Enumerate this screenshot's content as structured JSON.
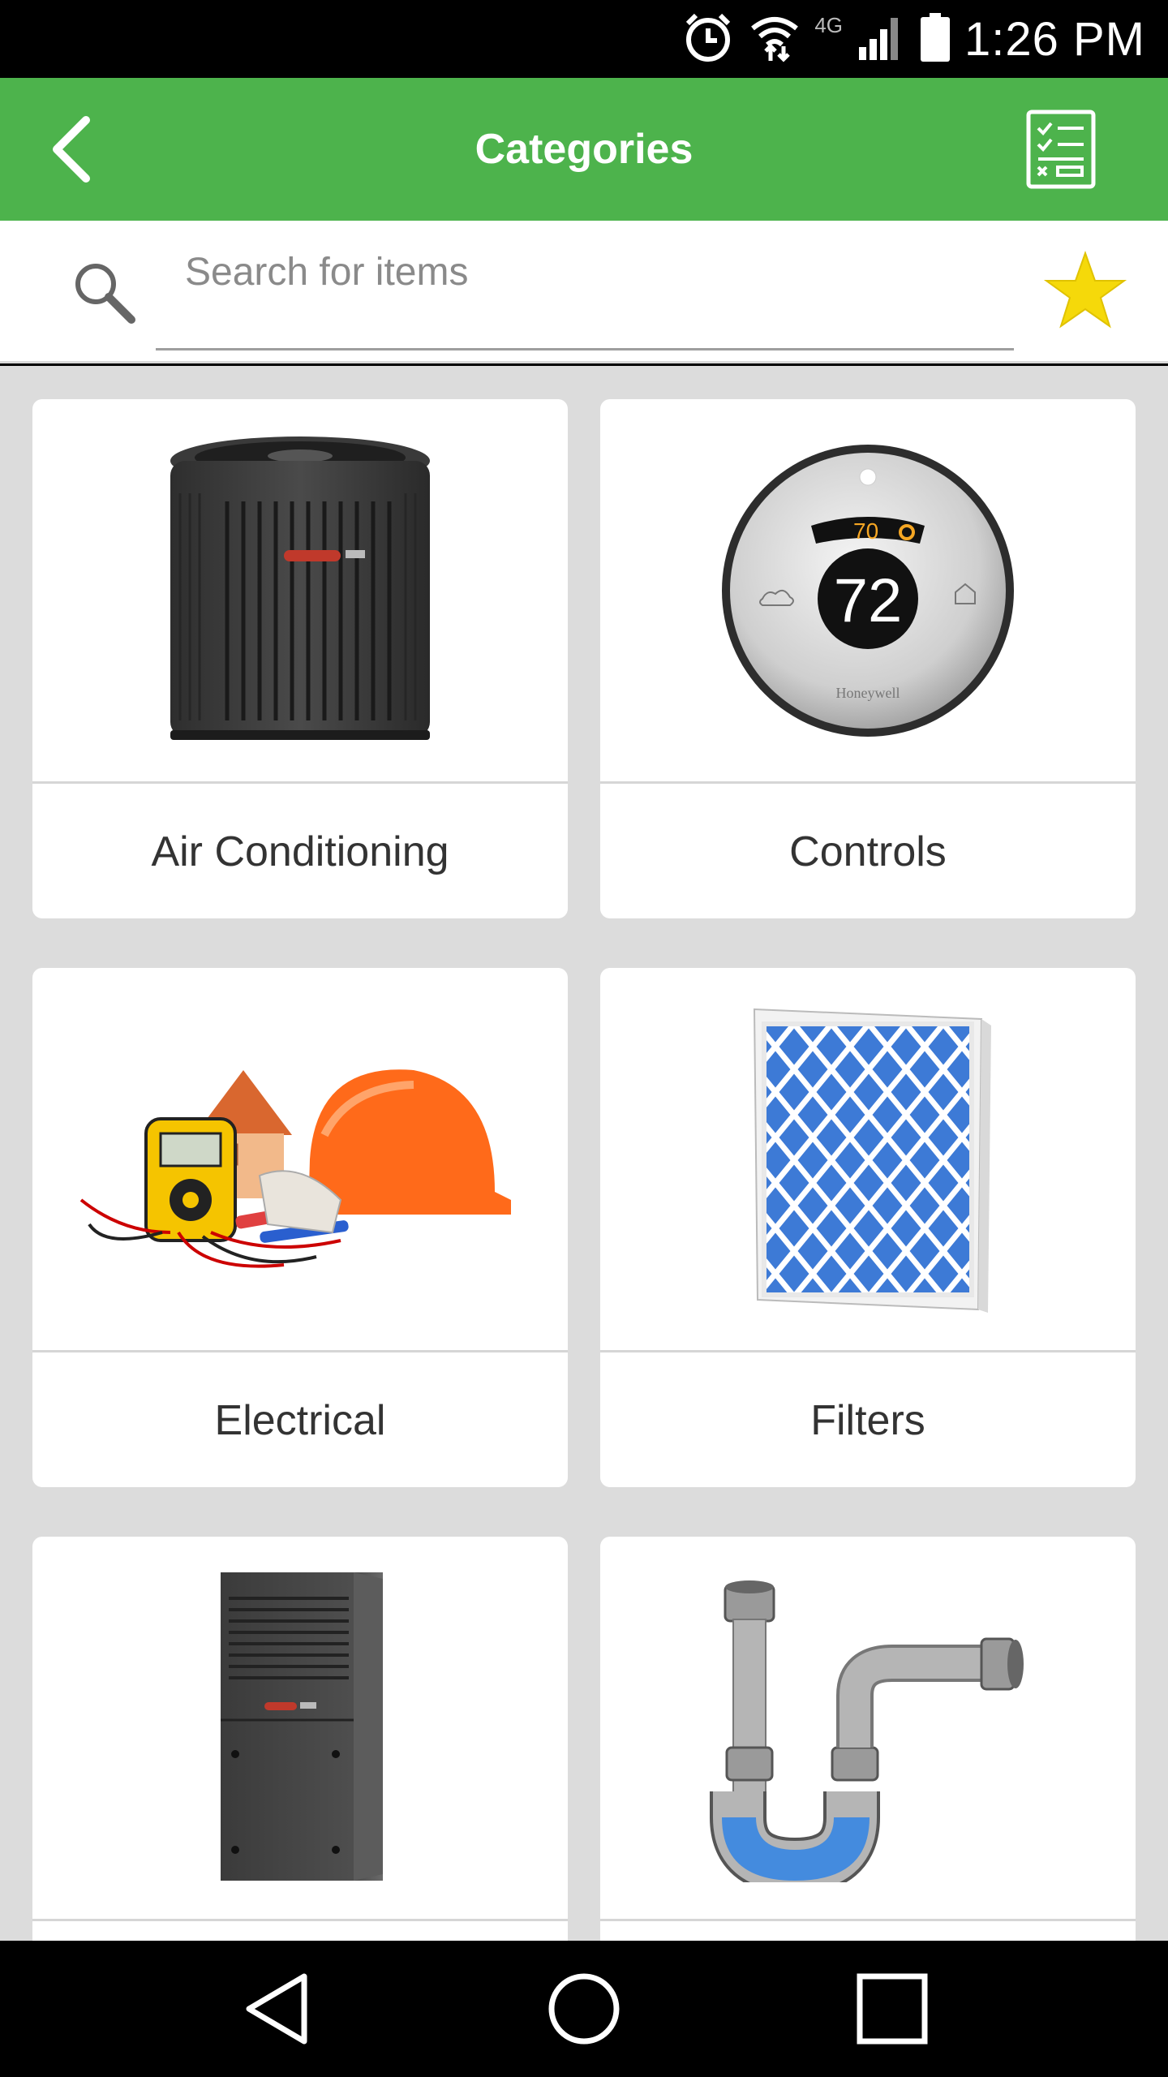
{
  "status_bar": {
    "time": "1:26 PM",
    "network": "4G",
    "icons": [
      "alarm-icon",
      "wifi-icon",
      "signal-icon",
      "battery-icon"
    ]
  },
  "app_bar": {
    "title": "Categories",
    "back_icon": "chevron-left-icon",
    "action_icon": "checklist-icon",
    "background_color": "#4db34c"
  },
  "search": {
    "placeholder": "Search for items",
    "value": "",
    "favorite_icon": "star-icon",
    "favorite_color": "#f5d90a"
  },
  "categories": [
    {
      "label": "Air Conditioning",
      "image": "ac-condenser-unit"
    },
    {
      "label": "Controls",
      "image": "round-thermostat",
      "thermostat_setpoint": "70",
      "thermostat_current": "72",
      "brand": "Honeywell"
    },
    {
      "label": "Electrical",
      "image": "multimeter-and-hard-hat"
    },
    {
      "label": "Filters",
      "image": "pleated-air-filter"
    },
    {
      "label": "",
      "image": "furnace-unit"
    },
    {
      "label": "",
      "image": "p-trap-pipe"
    }
  ],
  "nav_bar": {
    "icons": [
      "back-triangle-icon",
      "home-circle-icon",
      "recents-square-icon"
    ]
  }
}
